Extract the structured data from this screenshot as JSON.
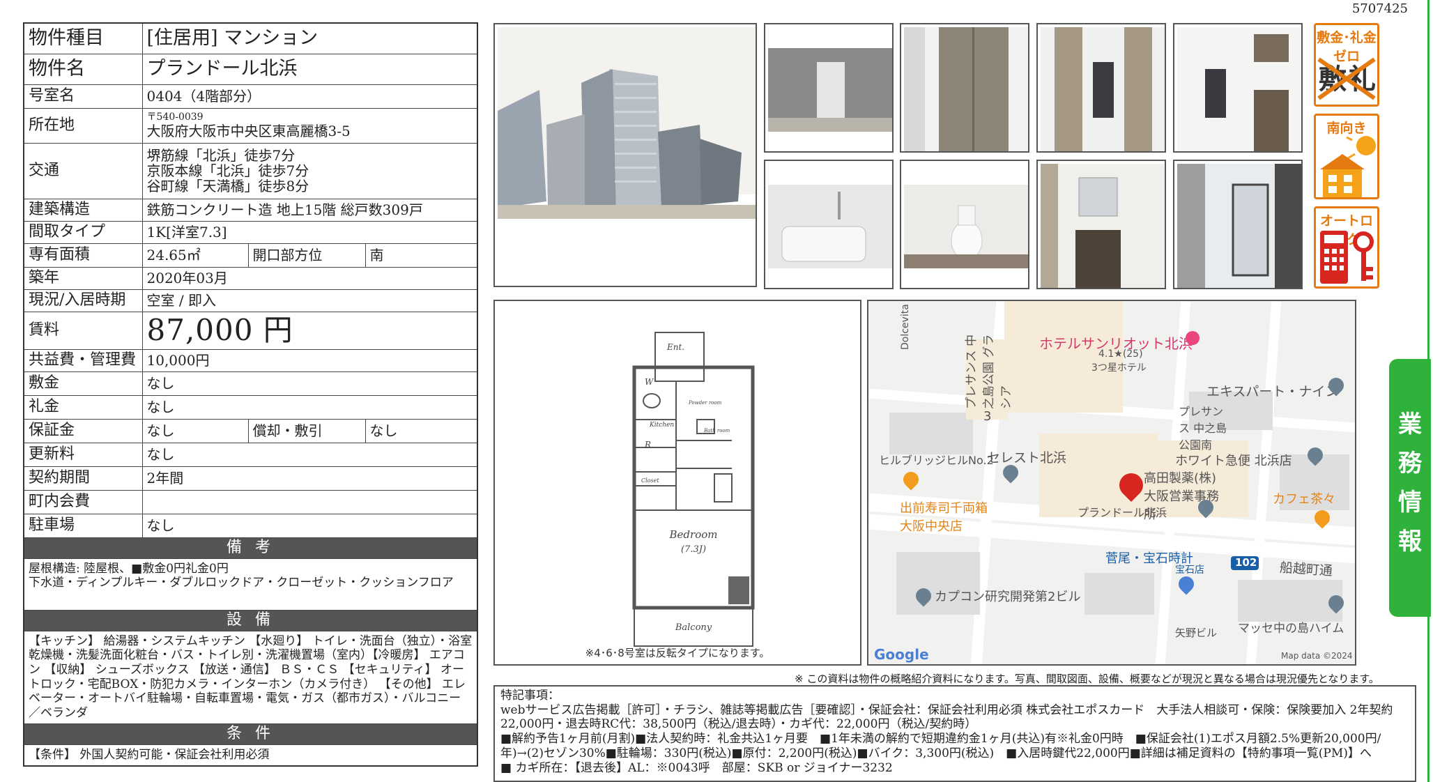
{
  "doc_id": "5707425",
  "property": {
    "type_label": "物件種目",
    "type_value": "[住居用] マンション",
    "name_label": "物件名",
    "name_value": "プランドール北浜",
    "room_label": "号室名",
    "room_value": "0404（4階部分）",
    "address_label": "所在地",
    "postal": "〒540-0039",
    "address": "大阪府大阪市中央区東高麗橋3-5",
    "transport_label": "交通",
    "transport": [
      "堺筋線「北浜」徒歩7分",
      "京阪本線「北浜」徒歩7分",
      "谷町線「天満橋」徒歩8分"
    ],
    "structure_label": "建築構造",
    "structure_value": "鉄筋コンクリート造 地上15階 総戸数309戸",
    "layout_label": "間取タイプ",
    "layout_value": "1K[洋室7.3]",
    "area_label": "専有面積",
    "area_value": "24.65㎡",
    "opening_label": "開口部方位",
    "opening_value": "南",
    "built_label": "築年",
    "built_value": "2020年03月",
    "status_label": "現況/入居時期",
    "status_value": "空室 / 即入",
    "rent_label": "賃料",
    "rent_value": "87,000 円",
    "fee_label": "共益費・管理費",
    "fee_value": "10,000円",
    "deposit_label": "敷金",
    "deposit_value": "なし",
    "key_money_label": "礼金",
    "key_money_value": "なし",
    "guarantee_label": "保証金",
    "guarantee_value": "なし",
    "amort_label": "償却・敷引",
    "amort_value": "なし",
    "renewal_label": "更新料",
    "renewal_value": "なし",
    "contract_label": "契約期間",
    "contract_value": "2年間",
    "town_fee_label": "町内会費",
    "town_fee_value": "",
    "parking_label": "駐車場",
    "parking_value": "なし"
  },
  "remarks": {
    "title": "備 考",
    "body": "屋根構造: 陸屋根、■敷金0円礼金0円\n下水道・ディンプルキー・ダブルロックドア・クローゼット・クッションフロア"
  },
  "facilities": {
    "title": "設 備",
    "body": "【キッチン】 給湯器・システムキッチン 【水廻り】 トイレ・洗面台（独立）・浴室乾燥機・洗髪洗面化粧台・バス・トイレ別・洗濯機置場（室内）【冷暖房】 エアコン 【収納】 シューズボックス 【放送・通信】 ＢＳ・ＣＳ 【セキュリティ】 オートロック・宅配BOX・防犯カメラ・インターホン（カメラ付き） 【その他】 エレベーター・オートバイ駐輪場・自転車置場・電気・ガス（都市ガス）・バルコニー／ベランダ"
  },
  "conditions": {
    "title": "条 件",
    "body": "【条件】 外国人契約可能・保証会社利用必須"
  },
  "badges": {
    "zero": "敷金･礼金ゼロ",
    "south": "南向き",
    "autolock": "オートロック"
  },
  "badge_icons": [
    "no-deposit-icon",
    "sun-house-icon",
    "keypad-key-icon"
  ],
  "side_tab": [
    "業",
    "務",
    "情",
    "報"
  ],
  "floor_plan": {
    "ent": "Ent.",
    "w": "W",
    "r": "R",
    "kitchen": "Kitchen",
    "powder": "Powder room",
    "bath": "Bath room",
    "closet": "Closet",
    "bedroom": "Bedroom",
    "bedroom_size": "(7.3J)",
    "balcony": "Balcony",
    "note": "※4･6･8号室は反転タイプになります。"
  },
  "map": {
    "dolcevita": "Dolcevita KITAHAMA",
    "plessance_glass": "プレサンス 中之島公園 グラシア",
    "hotel": "ホテルサンリオット北浜",
    "hotel_rating": "4.1★(25)",
    "hotel_class": "3つ星ホテル",
    "expert": "エキスパート・ナイン",
    "plessance_south": "プレサンス 中之島 公園南",
    "num3": "3",
    "hilbridge": "ヒルブリッジヒルNo.2",
    "celest": "セレスト北浜",
    "white": "ホワイト急便 北浜店",
    "takada": "高田製薬(株) 大阪営業事務所",
    "target": "プランドール北浜",
    "sushi": "出前寿司千両箱 大阪中央店",
    "cafe": "カフェ茶々",
    "sugao": "菅尾・宝石時計",
    "sugao2": "宝石店",
    "route": "102",
    "funakoshi": "船越町通",
    "capcom": "カプコン研究開発第2ビル",
    "yano": "矢野ビル",
    "masse": "マッセ中の島ハイム",
    "google": "Google",
    "mapdata": "Map data ©2024"
  },
  "disclaimer": "※ この資料は物件の概略紹介資料になります。写真、間取図面、設備、概要などが現況と異なる場合は現況優先となります。",
  "notes": {
    "title": "特記事項：",
    "lines": [
      "webサービス広告掲載［許可］・チラシ、雑誌等掲載広告［要確認］・保証会社：保証会社利用必須 株式会社エポスカード　大手法人相談可・保険：保険要加入 2年契約 22,000円・退去時RC代：38,500円（税込/退去時）・カギ代：22,000円（税込/契約時）",
      "■解約予告1ヶ月前(月割)■法人契約時：礼金共込1ヶ月要　■1年未満の解約で短期違約金1ヶ月(共込)有※礼金0円時　■保証会社(1)エポス月額2.5%更新20,000円/年)→(2)セゾン30%■駐輪場：330円(税込)■原付：2,200円(税込)■バイク：3,300円(税込)　■入居時鍵代22,000円■詳細は補足資料の【特約事項一覧(PM)】へ",
      "■ カギ所在：【退去後】AL：※0043呼　部屋：SKB or ジョイナー3232"
    ]
  }
}
